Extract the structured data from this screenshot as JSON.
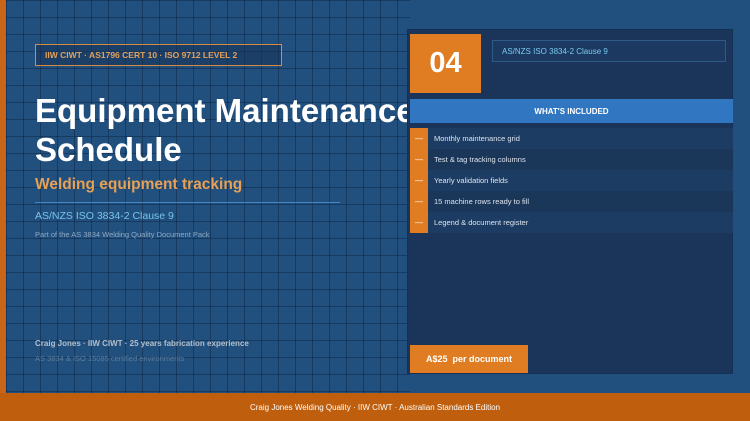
{
  "badge": "IIW CIWT  ·  AS1796 CERT 10  ·  ISO 9712 LEVEL 2",
  "title": "Equipment Maintenance Schedule",
  "subtitle": "Welding equipment tracking",
  "standard": "AS/NZS ISO 3834-2 Clause 9",
  "pack_note": "Part of the AS 3834 Welding Quality Document Pack",
  "author_line": "Craig Jones  ·  IIW CIWT  ·  25 years fabrication experience",
  "environments": "AS 3834 & ISO 15085 certified environments",
  "panel": {
    "number": "04",
    "reference": "AS/NZS ISO 3834-2 Clause 9",
    "included_title": "WHAT'S INCLUDED",
    "bullet": "—",
    "items": [
      "Monthly maintenance grid",
      "Test & tag tracking columns",
      "Yearly validation fields",
      "15 machine rows ready to fill",
      "Legend & document register"
    ],
    "price": "A$25  per document"
  },
  "footer": "Craig Jones Welding Quality  ·  IIW CIWT  ·  Australian Standards Edition",
  "colors": {
    "background": "#1f4e7c",
    "accent": "#e07d22",
    "footer": "#bf5e0c",
    "header_blue": "#3176c0",
    "link_blue": "#78c4ec"
  }
}
